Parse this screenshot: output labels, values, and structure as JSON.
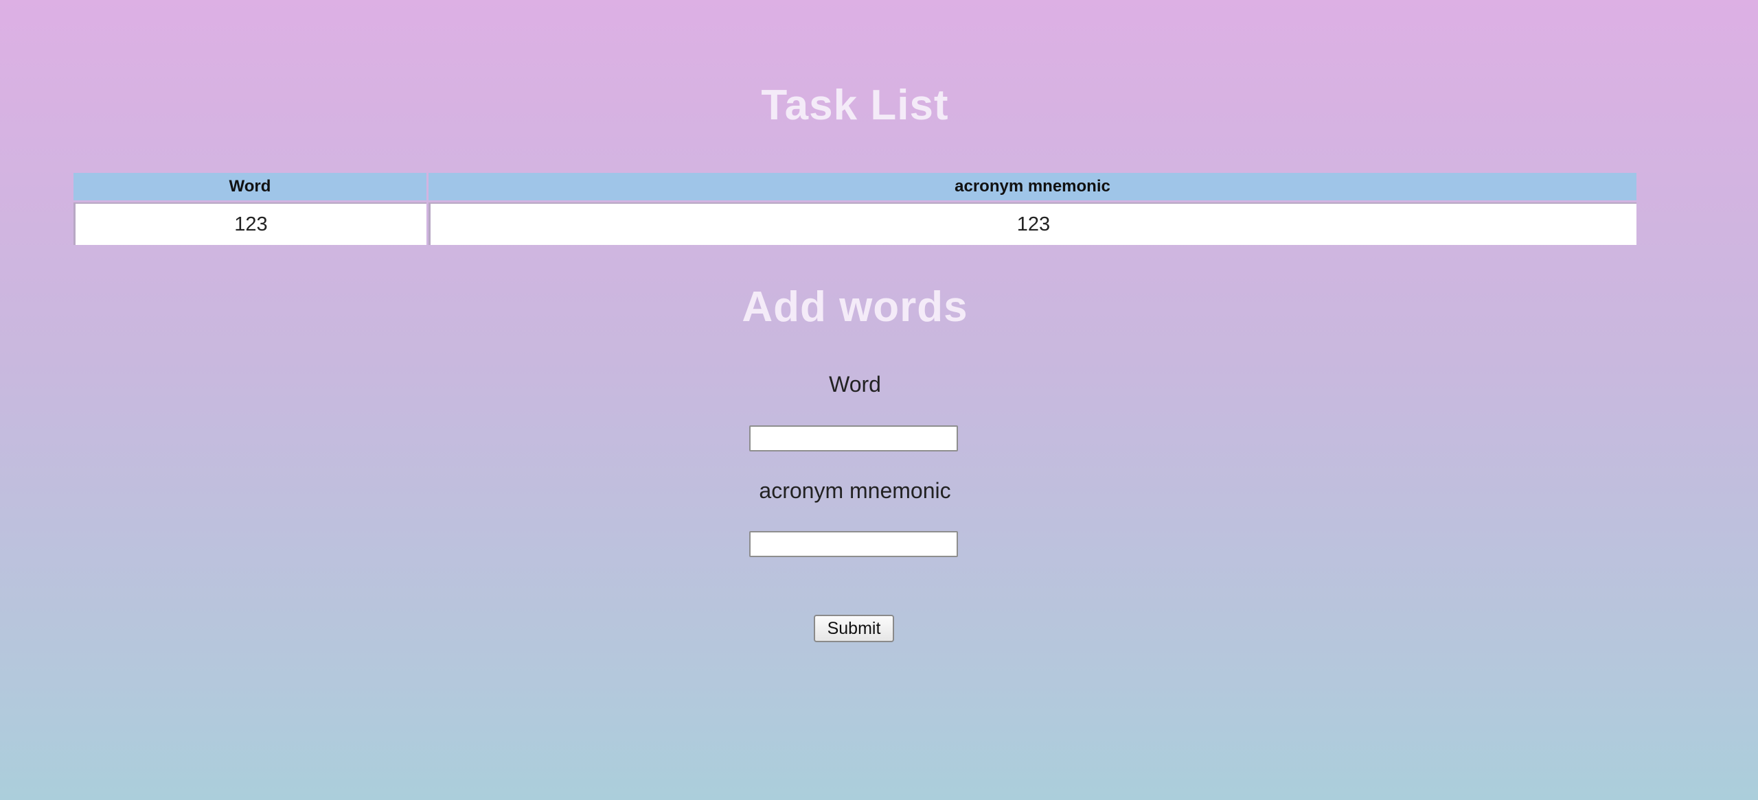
{
  "task_list": {
    "title": "Task List",
    "columns": [
      "Word",
      "acronym mnemonic"
    ],
    "rows": [
      [
        "123",
        "123"
      ]
    ]
  },
  "add_words": {
    "title": "Add words",
    "word_label": "Word",
    "word_value": "",
    "mnemonic_label": "acronym mnemonic",
    "mnemonic_value": "",
    "submit_label": "Submit"
  }
}
